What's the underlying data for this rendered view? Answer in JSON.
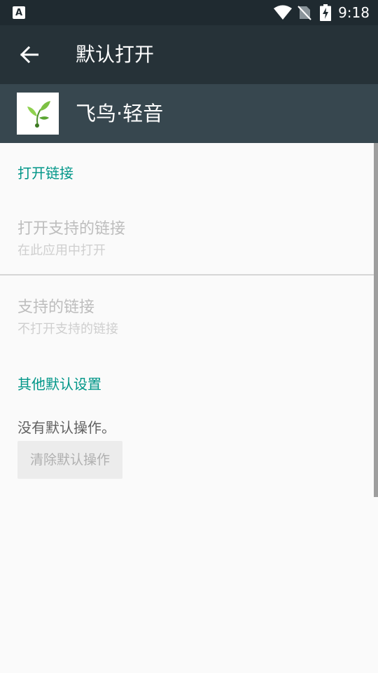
{
  "status_bar": {
    "time": "9:18",
    "left_icon": "A",
    "icons": [
      "wifi-icon",
      "no-sim-icon",
      "battery-charging-icon"
    ]
  },
  "toolbar": {
    "title": "默认打开",
    "back_icon": "arrow-back-icon"
  },
  "app": {
    "name": "飞鸟·轻音"
  },
  "sections": {
    "open_links": {
      "header": "打开链接",
      "open_supported": {
        "title": "打开支持的链接",
        "summary": "在此应用中打开"
      },
      "supported_links": {
        "title": "支持的链接",
        "summary": "不打开支持的链接"
      }
    },
    "other_defaults": {
      "header": "其他默认设置",
      "message": "没有默认操作。",
      "clear_button": "清除默认操作"
    }
  },
  "colors": {
    "status_bar": "#1f2a30",
    "toolbar": "#263238",
    "app_header": "#37474f",
    "accent": "#009688",
    "background": "#fafafa"
  }
}
